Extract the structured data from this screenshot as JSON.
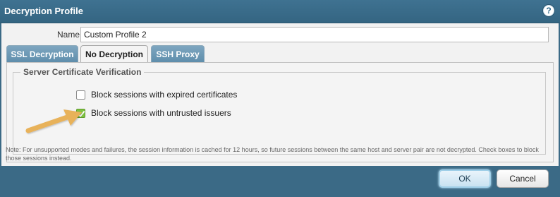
{
  "dialog": {
    "title": "Decryption Profile",
    "help_symbol": "?"
  },
  "name_field": {
    "label": "Name",
    "value": "Custom Profile 2"
  },
  "tabs": [
    {
      "label": "SSL Decryption",
      "active": false
    },
    {
      "label": "No Decryption",
      "active": true
    },
    {
      "label": "SSH Proxy",
      "active": false
    }
  ],
  "server_cert_group": {
    "legend": "Server Certificate Verification",
    "options": [
      {
        "label": "Block sessions with expired certificates",
        "checked": false
      },
      {
        "label": "Block sessions with untrusted issuers",
        "checked": true
      }
    ]
  },
  "note": "Note: For unsupported modes and failures, the session information is cached for 12 hours, so future sessions between the same host and server pair are not decrypted. Check boxes to block those sessions instead.",
  "buttons": {
    "ok": "OK",
    "cancel": "Cancel"
  },
  "colors": {
    "accent_arrow": "#e8b25a",
    "check_green": "#7fc241",
    "title_bar": "#3b6a86"
  }
}
